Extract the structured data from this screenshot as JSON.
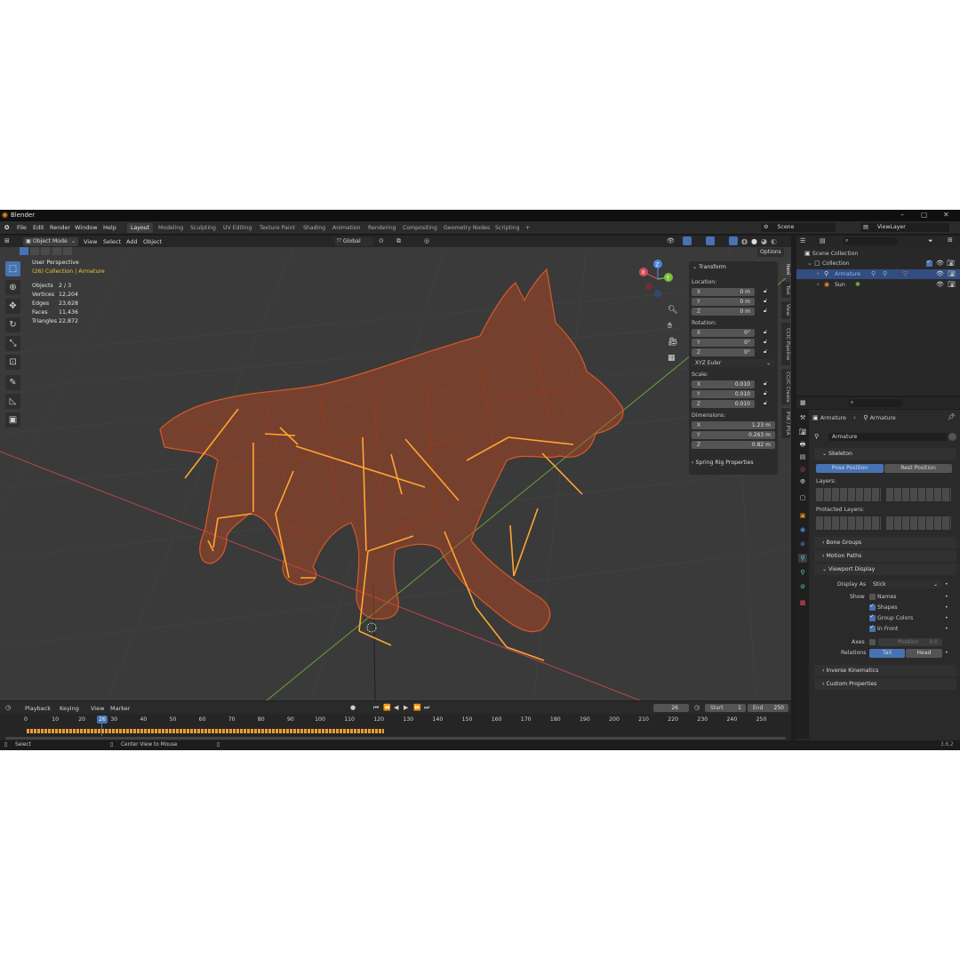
{
  "app": {
    "title": "Blender",
    "version": "3.6.2"
  },
  "menu": [
    "File",
    "Edit",
    "Render",
    "Window",
    "Help"
  ],
  "workspaces": [
    "Layout",
    "Modeling",
    "Sculpting",
    "UV Editing",
    "Texture Paint",
    "Shading",
    "Animation",
    "Rendering",
    "Compositing",
    "Geometry Nodes",
    "Scripting"
  ],
  "active_workspace": "Layout",
  "scene": "Scene",
  "view_layer": "ViewLayer",
  "viewport_header": {
    "mode": "Object Mode",
    "menus": [
      "View",
      "Select",
      "Add",
      "Object"
    ],
    "orientation": "Global",
    "options": "Options"
  },
  "overlay": {
    "perspective": "User Perspective",
    "context": "(26) Collection | Armature",
    "stats": [
      {
        "label": "Objects",
        "value": "2 / 3"
      },
      {
        "label": "Vertices",
        "value": "12,204"
      },
      {
        "label": "Edges",
        "value": "23,628"
      },
      {
        "label": "Faces",
        "value": "11,436"
      },
      {
        "label": "Triangles",
        "value": "22,872"
      }
    ]
  },
  "gizmo": {
    "x": "X",
    "y": "Y",
    "z": "Z"
  },
  "npanel": {
    "title": "Transform",
    "location_label": "Location:",
    "location": [
      {
        "axis": "X",
        "value": "0 m"
      },
      {
        "axis": "Y",
        "value": "0 m"
      },
      {
        "axis": "Z",
        "value": "0 m"
      }
    ],
    "rotation_label": "Rotation:",
    "rotation": [
      {
        "axis": "X",
        "value": "0°"
      },
      {
        "axis": "Y",
        "value": "0°"
      },
      {
        "axis": "Z",
        "value": "0°"
      }
    ],
    "rotation_mode": "XYZ Euler",
    "scale_label": "Scale:",
    "scale": [
      {
        "axis": "X",
        "value": "0.010"
      },
      {
        "axis": "Y",
        "value": "0.010"
      },
      {
        "axis": "Z",
        "value": "0.010"
      }
    ],
    "dimensions_label": "Dimensions:",
    "dimensions": [
      {
        "axis": "X",
        "value": "1.23 m"
      },
      {
        "axis": "Y",
        "value": "0.263 m"
      },
      {
        "axis": "Z",
        "value": "0.82 m"
      }
    ],
    "spring": "Spring Rig Properties",
    "tabs": [
      "Item",
      "Tool",
      "View",
      "CCIC Pipeline",
      "CC/iC Create",
      "PSK / PSA"
    ]
  },
  "outliner": {
    "scene_collection": "Scene Collection",
    "collection": "Collection",
    "items": [
      "Armature",
      "Sun"
    ]
  },
  "properties": {
    "breadcrumb": [
      "Armature",
      "Armature"
    ],
    "data_name": "Armature",
    "skeleton": "Skeleton",
    "pose_position": "Pose Position",
    "rest_position": "Rest Position",
    "layers": "Layers:",
    "protected_layers": "Protected Layers:",
    "bone_groups": "Bone Groups",
    "motion_paths": "Motion Paths",
    "viewport_display": "Viewport Display",
    "display_as_label": "Display As",
    "display_as": "Stick",
    "show_label": "Show",
    "show_names": "Names",
    "show_shapes": "Shapes",
    "show_group_colors": "Group Colors",
    "show_in_front": "In Front",
    "axes_label": "Axes",
    "axes_position": "Position",
    "axes_value": "0.0",
    "relations_label": "Relations",
    "relations_tail": "Tail",
    "relations_head": "Head",
    "inverse_kinematics": "Inverse Kinematics",
    "custom_properties": "Custom Properties"
  },
  "timeline": {
    "menus": [
      "Playback",
      "Keying",
      "View",
      "Marker"
    ],
    "current_frame": "26",
    "start_label": "Start",
    "start": "1",
    "end_label": "End",
    "end": "250",
    "ticks": [
      "0",
      "10",
      "20",
      "30",
      "40",
      "50",
      "60",
      "70",
      "80",
      "90",
      "100",
      "110",
      "120",
      "130",
      "140",
      "150",
      "160",
      "170",
      "180",
      "190",
      "200",
      "210",
      "220",
      "230",
      "240",
      "250"
    ]
  },
  "status": {
    "select": "Select",
    "center": "Center View to Mouse"
  },
  "colors": {
    "accent": "#4772b3",
    "wire": "#c04a21",
    "bone": "#ffa530",
    "active_text": "#f0c040"
  }
}
